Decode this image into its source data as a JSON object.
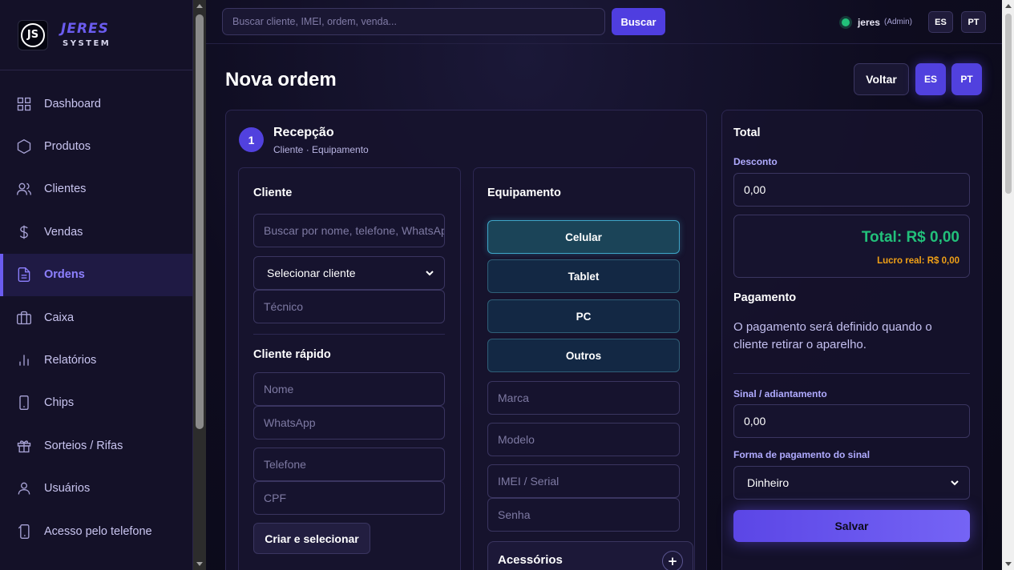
{
  "brand": {
    "logo": "JS",
    "title": "JERES",
    "subtitle": "SYSTEM"
  },
  "sidebar": {
    "items": [
      {
        "label": "Dashboard",
        "icon": "grid-icon"
      },
      {
        "label": "Produtos",
        "icon": "hexagon-icon"
      },
      {
        "label": "Clientes",
        "icon": "users-icon"
      },
      {
        "label": "Vendas",
        "icon": "dollar-icon"
      },
      {
        "label": "Ordens",
        "icon": "document-icon",
        "active": true
      },
      {
        "label": "Caixa",
        "icon": "briefcase-icon"
      },
      {
        "label": "Relatórios",
        "icon": "bar-chart-icon"
      },
      {
        "label": "Chips",
        "icon": "phone-icon"
      },
      {
        "label": "Sorteios / Rifas",
        "icon": "gift-icon"
      },
      {
        "label": "Usuários",
        "icon": "user-icon"
      },
      {
        "label": "Acesso pelo telefone",
        "icon": "phone-access-icon"
      }
    ]
  },
  "topbar": {
    "search_placeholder": "Buscar cliente, IMEI, ordem, venda...",
    "search_button": "Buscar",
    "user": "jeres",
    "role": "(Admin)",
    "lang_es": "ES",
    "lang_pt": "PT",
    "status_color": "#22c07a"
  },
  "page": {
    "title": "Nova ordem",
    "back": "Voltar",
    "lang_es": "ES",
    "lang_pt": "PT"
  },
  "step": {
    "number": "1",
    "title": "Recepção",
    "subtitle": "Cliente · Equipamento"
  },
  "client": {
    "title": "Cliente",
    "search_placeholder": "Buscar por nome, telefone, WhatsApp",
    "select_value": "Selecionar cliente",
    "tech_placeholder": "Técnico",
    "quick_title": "Cliente rápido",
    "name_placeholder": "Nome",
    "whatsapp_placeholder": "WhatsApp",
    "phone_placeholder": "Telefone",
    "cpf_placeholder": "CPF",
    "create_button": "Criar e selecionar"
  },
  "equipment": {
    "title": "Equipamento",
    "types": [
      "Celular",
      "Tablet",
      "PC",
      "Outros"
    ],
    "selected": "Celular",
    "brand_placeholder": "Marca",
    "model_placeholder": "Modelo",
    "imei_placeholder": "IMEI / Serial",
    "password_placeholder": "Senha",
    "accessories": "Acessórios"
  },
  "summary": {
    "title": "Total",
    "discount_label": "Desconto",
    "discount_value": "0,00",
    "total": "Total: R$ 0,00",
    "profit": "Lucro real: R$ 0,00",
    "payment_title": "Pagamento",
    "payment_text": "O pagamento será definido quando o cliente retirar o aparelho.",
    "deposit_label": "Sinal / adiantamento",
    "deposit_value": "0,00",
    "deposit_method_label": "Forma de pagamento do sinal",
    "deposit_method_value": "Dinheiro",
    "save": "Salvar",
    "total_color": "#22c07a",
    "profit_color": "#f0a016"
  }
}
